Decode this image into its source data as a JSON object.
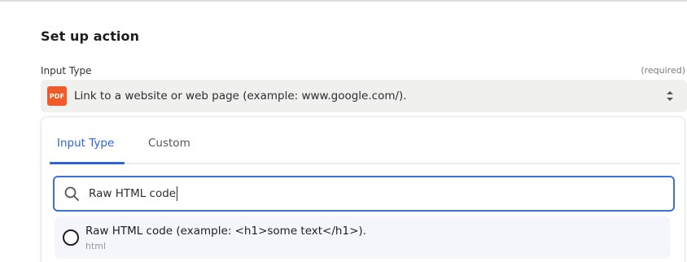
{
  "section": {
    "title": "Set up action"
  },
  "field": {
    "label": "Input Type",
    "required_note": "(required)",
    "selected_icon": "PDF",
    "selected_value": "Link to a website or web page (example: www.google.com/)."
  },
  "dropdown": {
    "tabs": [
      {
        "label": "Input Type",
        "active": true
      },
      {
        "label": "Custom",
        "active": false
      }
    ],
    "search": {
      "value": "Raw HTML code"
    },
    "options": [
      {
        "label": "Raw HTML code (example: <h1>some text</h1>).",
        "sublabel": "html",
        "selected": false
      }
    ]
  },
  "colors": {
    "accent": "#2f63d6",
    "pdf_icon": "#f05a28",
    "select_bg": "#f0f0ef",
    "option_bg": "#f4f6fb"
  }
}
